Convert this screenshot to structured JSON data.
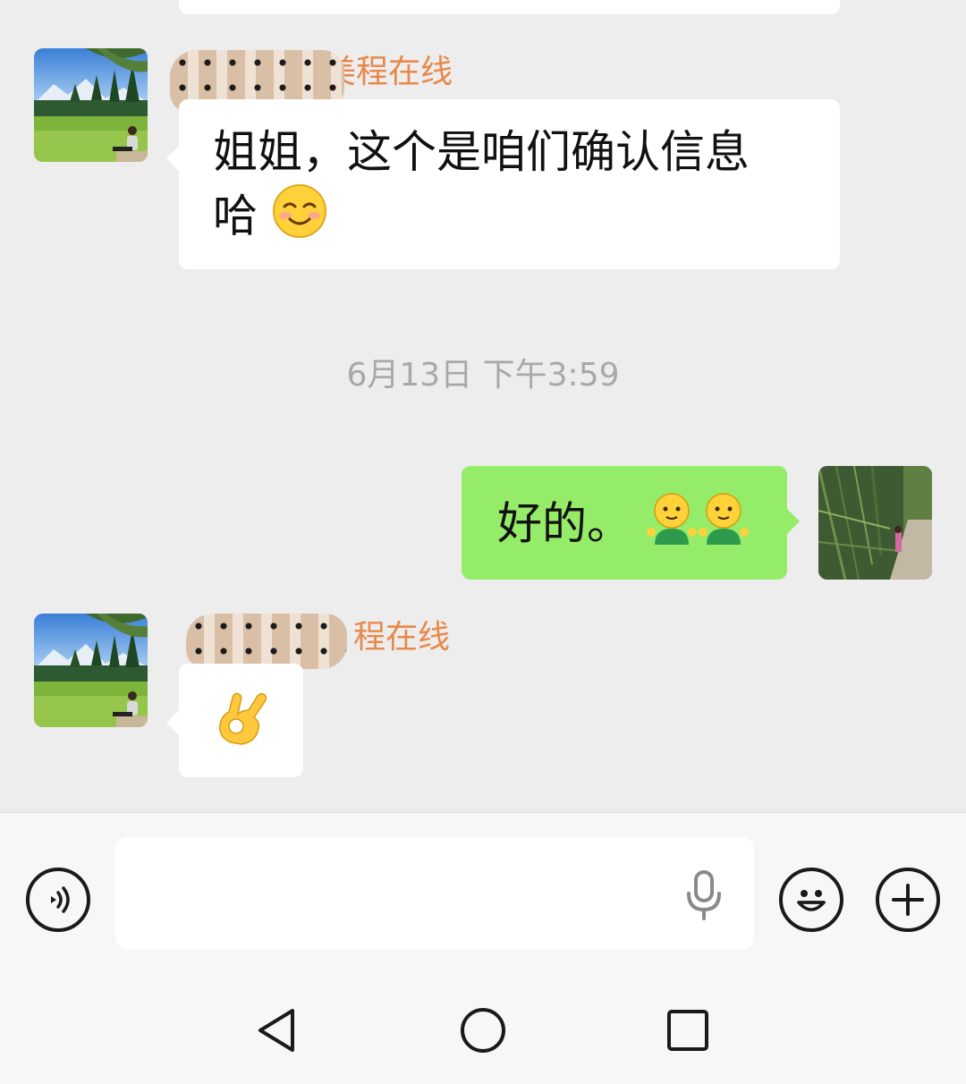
{
  "messages": [
    {
      "side": "left",
      "sender_visible": "美程在线",
      "text": "姐姐，这个是咱们确认信息",
      "text_line2": "哈",
      "emoji": "smiling-face-icon"
    },
    {
      "type": "timestamp",
      "text": "6月13日 下午3:59"
    },
    {
      "side": "right",
      "text": "好的。",
      "emoji": "hug-face-icon"
    },
    {
      "side": "left",
      "sender_visible": "程在线",
      "emoji": "ok-hand-icon"
    }
  ],
  "input": {
    "value": "",
    "placeholder": ""
  },
  "colors": {
    "background": "#ededed",
    "bubble_in": "#ffffff",
    "bubble_out": "#95ec69",
    "sender_name": "#e8884a",
    "timestamp": "#a8a8a8"
  },
  "icons": {
    "voice": "voice-input-icon",
    "mic": "microphone-icon",
    "emoji": "emoji-icon",
    "add": "plus-icon",
    "nav_back": "back-triangle-icon",
    "nav_home": "home-circle-icon",
    "nav_recent": "recents-square-icon"
  }
}
